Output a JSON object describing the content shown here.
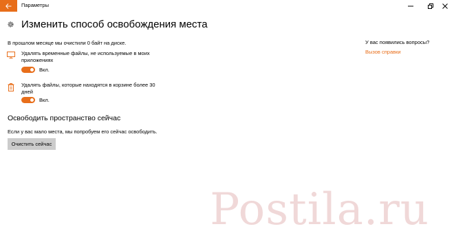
{
  "window": {
    "title": "Параметры"
  },
  "page": {
    "title": "Изменить способ освобождения места"
  },
  "summary": "В прошлом месяце мы очистили 0 байт на диске.",
  "options": [
    {
      "label": "Удалять временные файлы, не используемые в моих приложениях",
      "toggle_state": "Вкл.",
      "icon": "temp-files-icon"
    },
    {
      "label": "Удалять файлы, которые находятся в корзине более 30 дней",
      "toggle_state": "Вкл.",
      "icon": "recycle-bin-icon"
    }
  ],
  "free_now": {
    "title": "Освободить пространство сейчас",
    "description": "Если у вас мало места, мы попробуем его сейчас освободить.",
    "button_label": "Очистить сейчас"
  },
  "help": {
    "question": "У вас появились вопросы?",
    "link": "Вызов справки"
  },
  "watermark": "Postila.ru",
  "colors": {
    "accent": "#e86e1a",
    "button_bg": "#cccccc",
    "watermark": "#f0d8d8"
  }
}
